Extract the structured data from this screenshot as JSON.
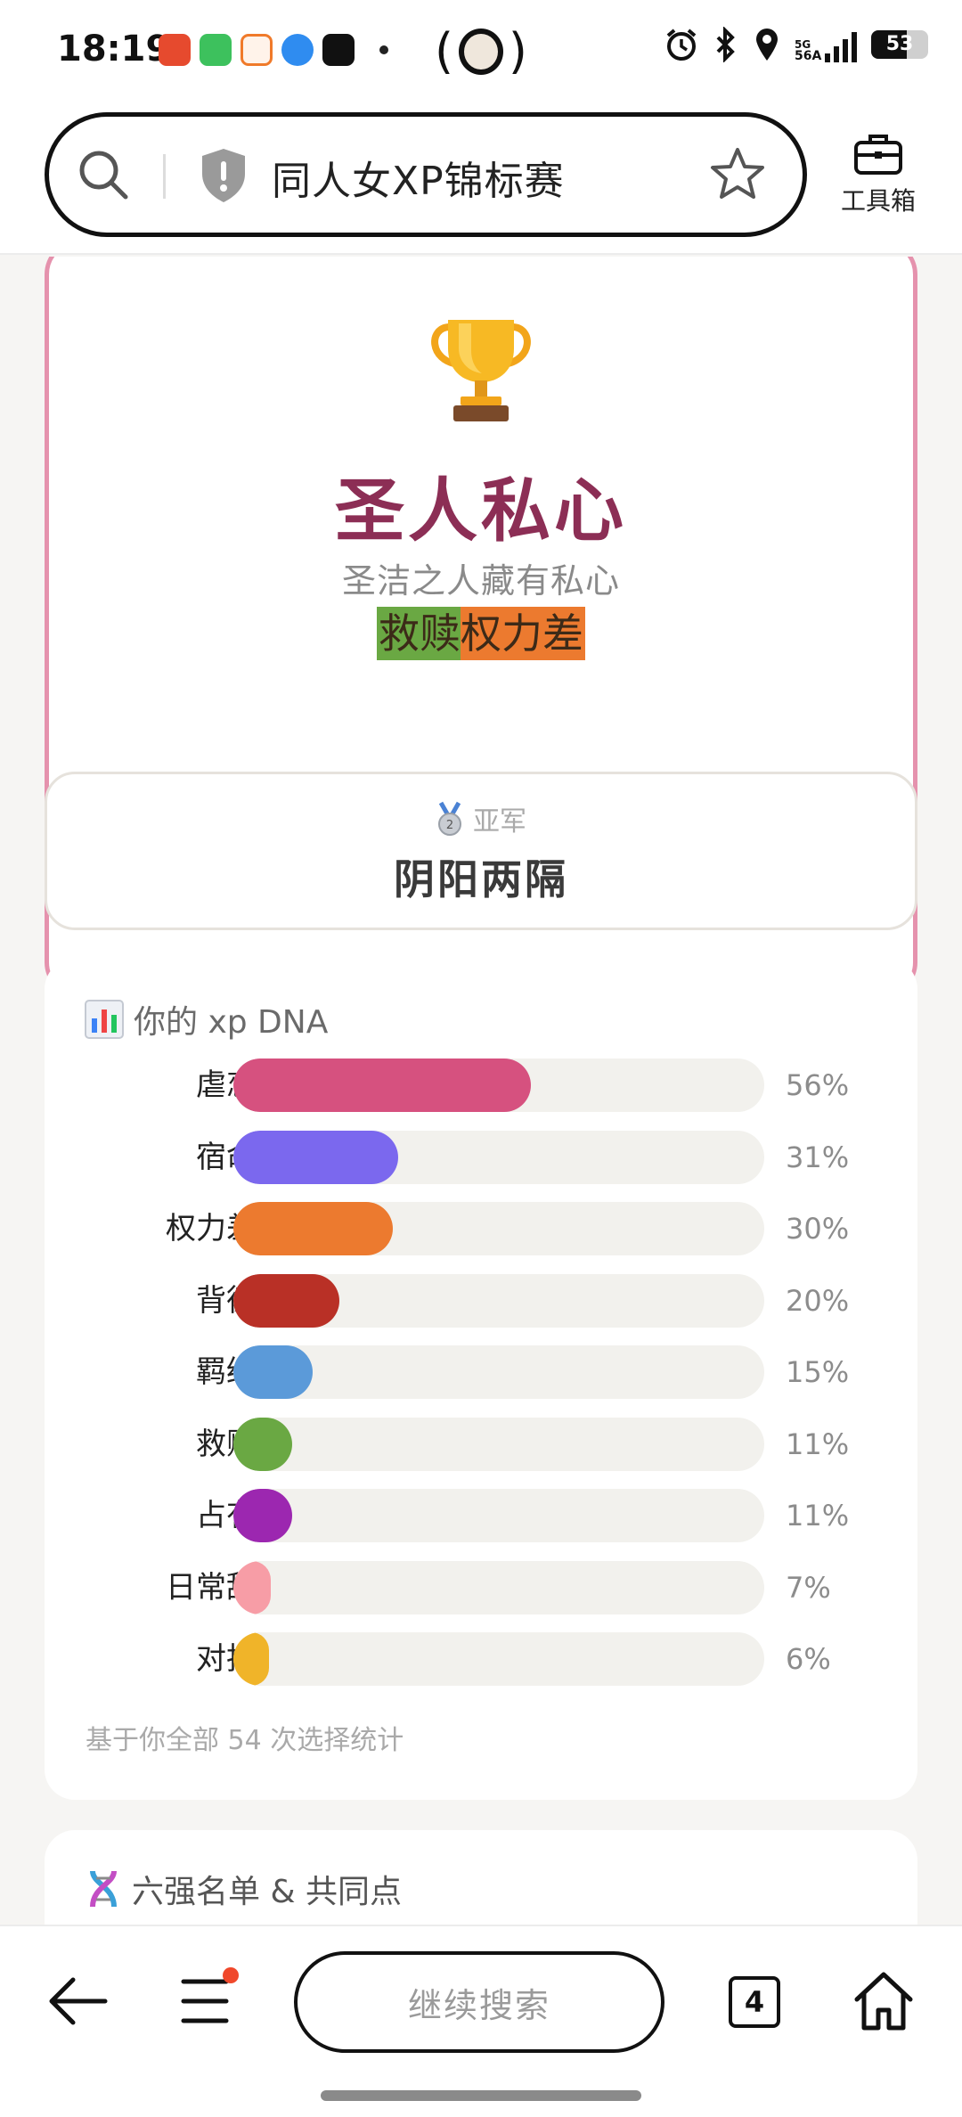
{
  "status_bar": {
    "time": "18:19",
    "network": "5G",
    "network_sub": "56A",
    "battery": "53"
  },
  "address_bar": {
    "title": "同人女XP锦标赛",
    "toolbox_label": "工具箱"
  },
  "champion": {
    "icon": "trophy-icon",
    "name": "圣人私心",
    "subtitle": "圣洁之人藏有私心",
    "tags": [
      "救赎",
      "权力差"
    ],
    "tag_colors": [
      "#6aa843",
      "#ec7a2f"
    ]
  },
  "runner_up": {
    "label": "亚军",
    "icon": "silver-medal-icon",
    "name": "阴阳两隔"
  },
  "dna": {
    "heading": "你的 xp DNA",
    "icon": "bar-chart-icon",
    "rows": [
      {
        "label": "虐恋",
        "percent": 56,
        "percent_text": "56%",
        "color": "#d6517f"
      },
      {
        "label": "宿命",
        "percent": 31,
        "percent_text": "31%",
        "color": "#7b68ee"
      },
      {
        "label": "权力差",
        "percent": 30,
        "percent_text": "30%",
        "color": "#ec7a2f"
      },
      {
        "label": "背德",
        "percent": 20,
        "percent_text": "20%",
        "color": "#b93026"
      },
      {
        "label": "羁绊",
        "percent": 15,
        "percent_text": "15%",
        "color": "#5b9ad9"
      },
      {
        "label": "救赎",
        "percent": 11,
        "percent_text": "11%",
        "color": "#6aa843"
      },
      {
        "label": "占有",
        "percent": 11,
        "percent_text": "11%",
        "color": "#9c27b0"
      },
      {
        "label": "日常甜",
        "percent": 7,
        "percent_text": "7%",
        "color": "#f79da6"
      },
      {
        "label": "对抗",
        "percent": 6,
        "percent_text": "6%",
        "color": "#f0b429"
      }
    ],
    "note": "基于你全部 54 次选择统计"
  },
  "six_strong": {
    "icon": "dna-icon",
    "heading": "六强名单 & 共同点"
  },
  "bottom_nav": {
    "continue_label": "继续搜索",
    "tab_count": "4"
  }
}
